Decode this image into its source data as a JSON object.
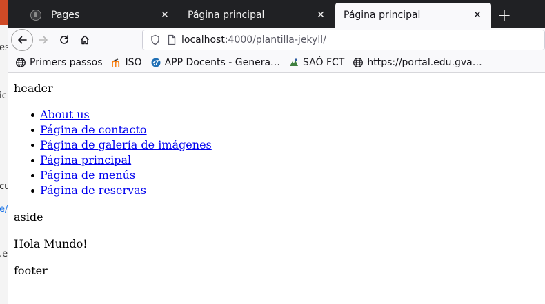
{
  "browser": {
    "tabs": [
      {
        "title": "Pages",
        "favicon": "github-icon",
        "active": false
      },
      {
        "title": "Página principal",
        "active": false
      },
      {
        "title": "Página principal",
        "active": true
      }
    ],
    "url": {
      "host": "localhost",
      "rest": ":4000/plantilla-jekyll/"
    },
    "bookmarks": [
      {
        "label": "Primers passos",
        "icon": "globe-icon"
      },
      {
        "label": "ISO",
        "icon": "moodle-icon"
      },
      {
        "label": "APP Docents - Genera…",
        "icon": "app-docents-icon"
      },
      {
        "label": "SAÓ FCT",
        "icon": "sao-icon"
      },
      {
        "label": "https://portal.edu.gva…",
        "icon": "globe-icon"
      }
    ]
  },
  "page": {
    "header": "header",
    "nav_links": [
      "About us",
      "Página de contacto",
      "Página de galería de imágenes",
      "Página principal",
      "Página de menús",
      "Página de reservas"
    ],
    "aside": "aside",
    "main": "Hola Mundo!",
    "footer": "footer"
  },
  "colors": {
    "tabbar_bg": "#202124",
    "toolbar_bg": "#f9f9fb",
    "link": "#0000ee",
    "background_window_accent": "#cf4a26"
  }
}
